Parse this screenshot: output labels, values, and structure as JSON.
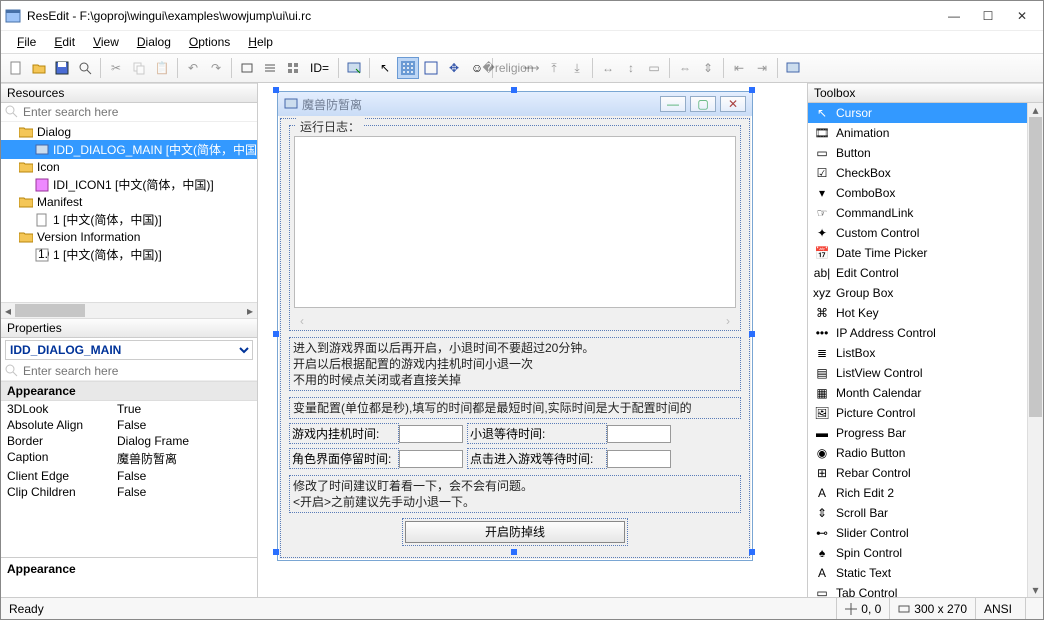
{
  "window": {
    "title": "ResEdit - F:\\goproj\\wingui\\examples\\wowjump\\ui\\ui.rc"
  },
  "menu": {
    "file": "File",
    "edit": "Edit",
    "view": "View",
    "dialog": "Dialog",
    "options": "Options",
    "help": "Help"
  },
  "toolbar": {
    "id_label": "ID="
  },
  "resources": {
    "title": "Resources",
    "search_ph": "Enter search here",
    "nodes": {
      "dialog": "Dialog",
      "dialog_main": "IDD_DIALOG_MAIN [中文(简体，中国)]",
      "icon": "Icon",
      "icon1": "IDI_ICON1 [中文(简体，中国)]",
      "manifest": "Manifest",
      "manifest1": "1 [中文(简体，中国)]",
      "version": "Version Information",
      "version1": "1 [中文(简体，中国)]"
    }
  },
  "properties": {
    "title": "Properties",
    "selector": "IDD_DIALOG_MAIN",
    "search_ph": "Enter search here",
    "group": "Appearance",
    "rows": {
      "look3d_k": "3DLook",
      "look3d_v": "True",
      "absalign_k": "Absolute Align",
      "absalign_v": "False",
      "border_k": "Border",
      "border_v": "Dialog Frame",
      "caption_k": "Caption",
      "caption_v": "魔兽防暂离",
      "clientedge_k": "Client Edge",
      "clientedge_v": "False",
      "clipchildren_k": "Clip Children",
      "clipchildren_v": "False"
    },
    "desc": "Appearance"
  },
  "dialog": {
    "title": "魔兽防暂离",
    "group_label": "运行日志：",
    "text1": "进入到游戏界面以后再开启，小退时间不要超过20分钟。\n开启以后根据配置的游戏内挂机时间小退一次\n不用的时候点关闭或者直接关掉",
    "text2": "变量配置(单位都是秒),填写的时间都是最短时间,实际时间是大于配置时间的",
    "lbl_game": "游戏内挂机时间:",
    "lbl_wait": "小退等待时间:",
    "lbl_stay": "角色界面停留时间:",
    "lbl_enter": "点击进入游戏等待时间:",
    "text3": "修改了时间建议盯着看一下，会不会有问题。\n<开启>之前建议先手动小退一下。",
    "button": "开启防掉线"
  },
  "toolbox": {
    "title": "Toolbox",
    "items": [
      "Cursor",
      "Animation",
      "Button",
      "CheckBox",
      "ComboBox",
      "CommandLink",
      "Custom Control",
      "Date Time Picker",
      "Edit Control",
      "Group Box",
      "Hot Key",
      "IP Address Control",
      "ListBox",
      "ListView Control",
      "Month Calendar",
      "Picture Control",
      "Progress Bar",
      "Radio Button",
      "Rebar Control",
      "Rich Edit 2",
      "Scroll Bar",
      "Slider Control",
      "Spin Control",
      "Static Text",
      "Tab Control"
    ]
  },
  "status": {
    "ready": "Ready",
    "coords": "0, 0",
    "size": "300 x 270",
    "enc": "ANSI"
  }
}
